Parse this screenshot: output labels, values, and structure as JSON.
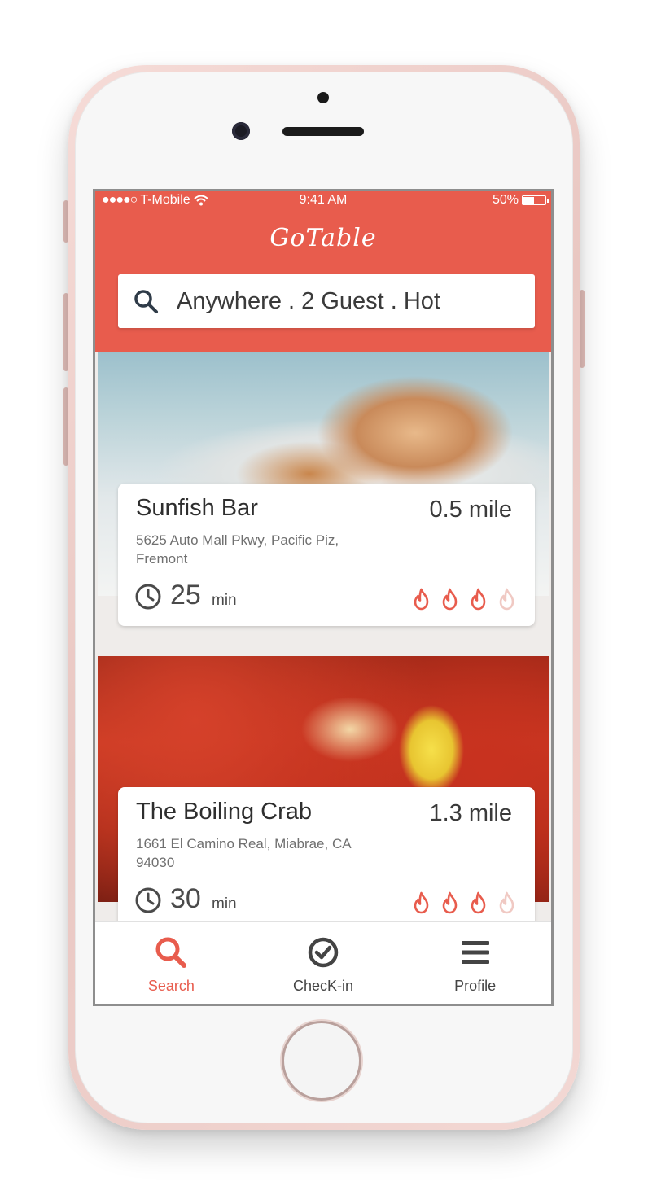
{
  "status_bar": {
    "signal_dots": "●●●●○",
    "carrier": "T-Mobile",
    "time": "9:41 AM",
    "battery": "50%",
    "battery_level": 0.5
  },
  "app": {
    "title": "GoTable",
    "accent_color": "#e85c4d"
  },
  "search": {
    "value": "Anywhere . 2 Guest . Hot",
    "icon": "search-icon"
  },
  "restaurants": [
    {
      "name": "Sunfish Bar",
      "distance": "0.5 mile",
      "address": "5625 Auto Mall Pkwy, Pacific Piz, Fremont",
      "wait": "25",
      "wait_unit": "min",
      "heat_rating": 3,
      "heat_max": 4
    },
    {
      "name": "The Boiling Crab",
      "distance": "1.3 mile",
      "address": "1661 El Camino Real, Miabrae, CA 94030",
      "wait": "30",
      "wait_unit": "min",
      "heat_rating": 3,
      "heat_max": 4
    }
  ],
  "tabbar": {
    "active": "search",
    "tabs": [
      {
        "label": "Search",
        "icon": "search-icon"
      },
      {
        "label": "ChecK-in",
        "icon": "check-circle-icon"
      },
      {
        "label": "Profile",
        "icon": "menu-icon"
      }
    ]
  }
}
